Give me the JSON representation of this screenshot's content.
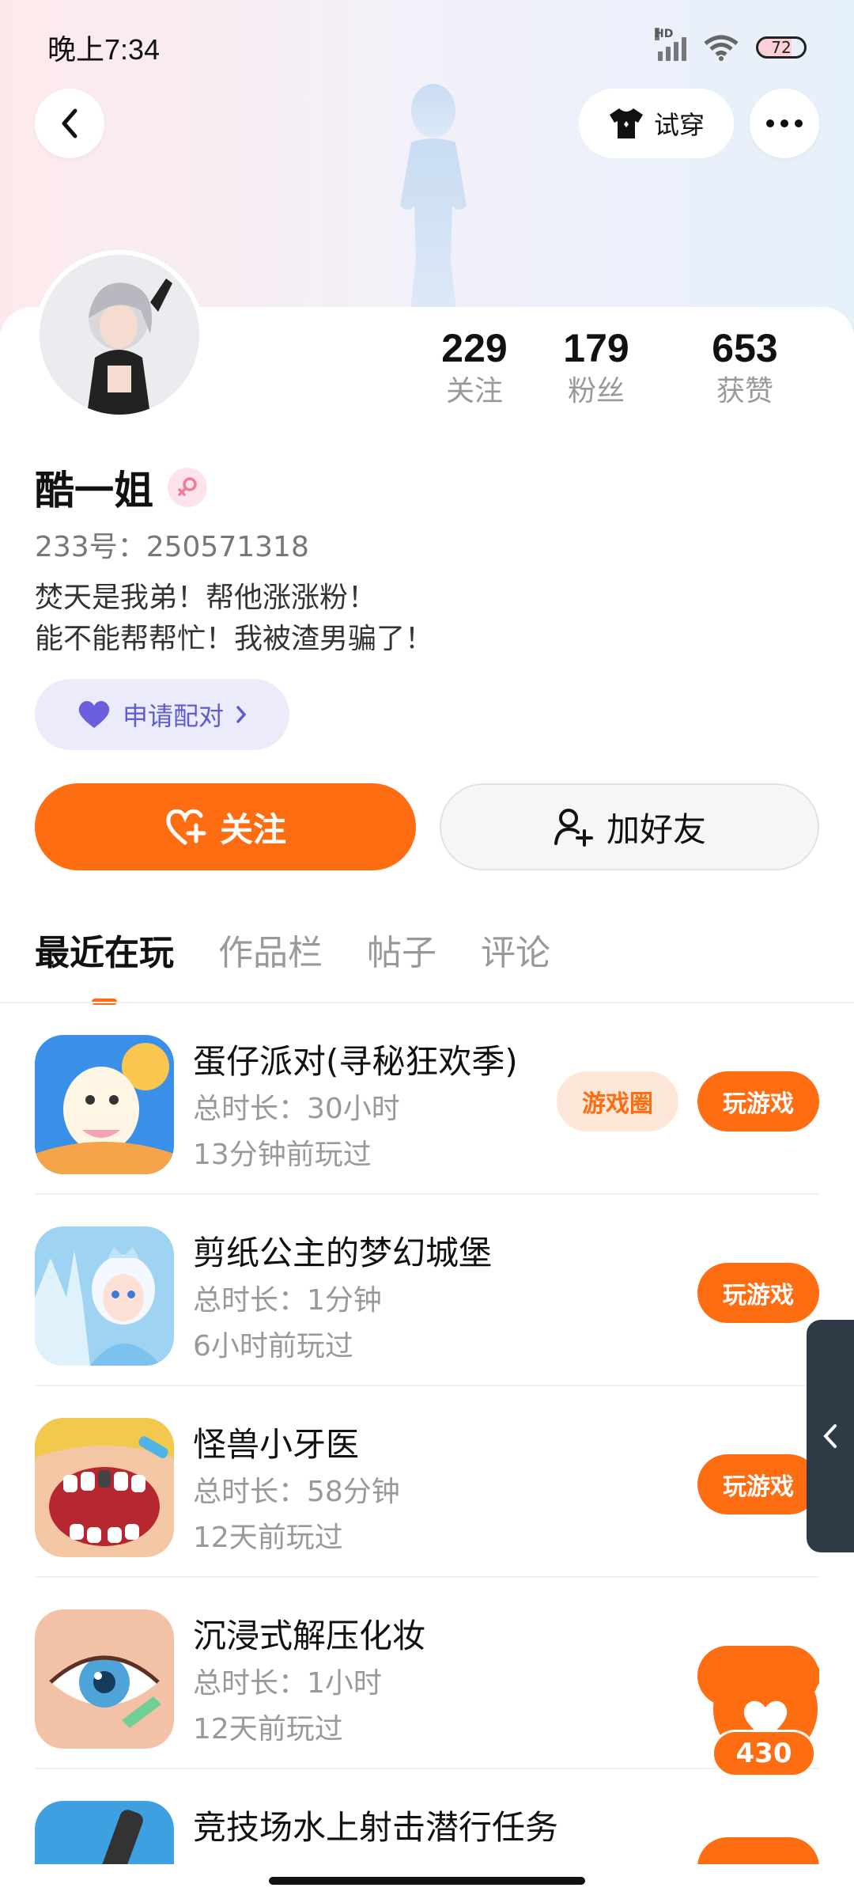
{
  "status_bar": {
    "time": "晚上7:34",
    "network_label": "HD",
    "battery": "72"
  },
  "header": {
    "try_on_label": "试穿"
  },
  "profile": {
    "stats": [
      {
        "value": "229",
        "label": "关注"
      },
      {
        "value": "179",
        "label": "粉丝"
      },
      {
        "value": "653",
        "label": "获赞"
      }
    ],
    "name": "酷一姐",
    "uid": "233号：250571318",
    "bio_line1": "焚天是我弟！帮他涨涨粉！",
    "bio_line2": "能不能帮帮忙！我被渣男骗了！",
    "pair_label": "申请配对",
    "follow_label": "关注",
    "add_friend_label": "加好友"
  },
  "tabs": [
    "最近在玩",
    "作品栏",
    "帖子",
    "评论"
  ],
  "games": [
    {
      "title": "蛋仔派对(寻秘狂欢季)",
      "duration": "总时长：30小时",
      "last_played": "13分钟前玩过",
      "circle_label": "游戏圈",
      "play_label": "玩游戏"
    },
    {
      "title": "剪纸公主的梦幻城堡",
      "duration": "总时长：1分钟",
      "last_played": "6小时前玩过",
      "play_label": "玩游戏"
    },
    {
      "title": "怪兽小牙医",
      "duration": "总时长：58分钟",
      "last_played": "12天前玩过",
      "play_label": "玩游戏"
    },
    {
      "title": "沉浸式解压化妆",
      "duration": "总时长：1小时",
      "last_played": "12天前玩过",
      "play_label": "玩游戏"
    },
    {
      "title": "竞技场水上射击潜行任务"
    }
  ],
  "like_bubble": {
    "count": "430"
  },
  "colors": {
    "accent": "#ff6d12",
    "pair_bg": "#ecebfb",
    "pair_text": "#5f5bd0"
  },
  "icons": [
    "back-arrow-icon",
    "shirt-icon",
    "more-icon",
    "heart-icon",
    "chevron-right-icon",
    "heart-plus-icon",
    "user-plus-icon",
    "side-chevron-icon",
    "female-icon"
  ]
}
